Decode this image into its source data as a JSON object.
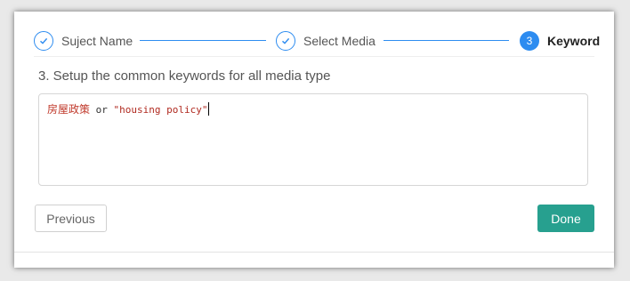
{
  "steps": [
    {
      "label": "Suject Name",
      "status": "done"
    },
    {
      "label": "Select Media",
      "status": "done"
    },
    {
      "label": "Keyword",
      "status": "active",
      "number": "3"
    }
  ],
  "section": {
    "title": "3. Setup the common keywords for all media type"
  },
  "keyword_input": {
    "term_zh": "房屋政策",
    "operator": "or",
    "term_en": "\"housing policy\""
  },
  "buttons": {
    "previous": "Previous",
    "done": "Done"
  },
  "colors": {
    "accent": "#2d8cf0",
    "done_button": "#27a08f",
    "keyword_term": "#b02a20"
  }
}
